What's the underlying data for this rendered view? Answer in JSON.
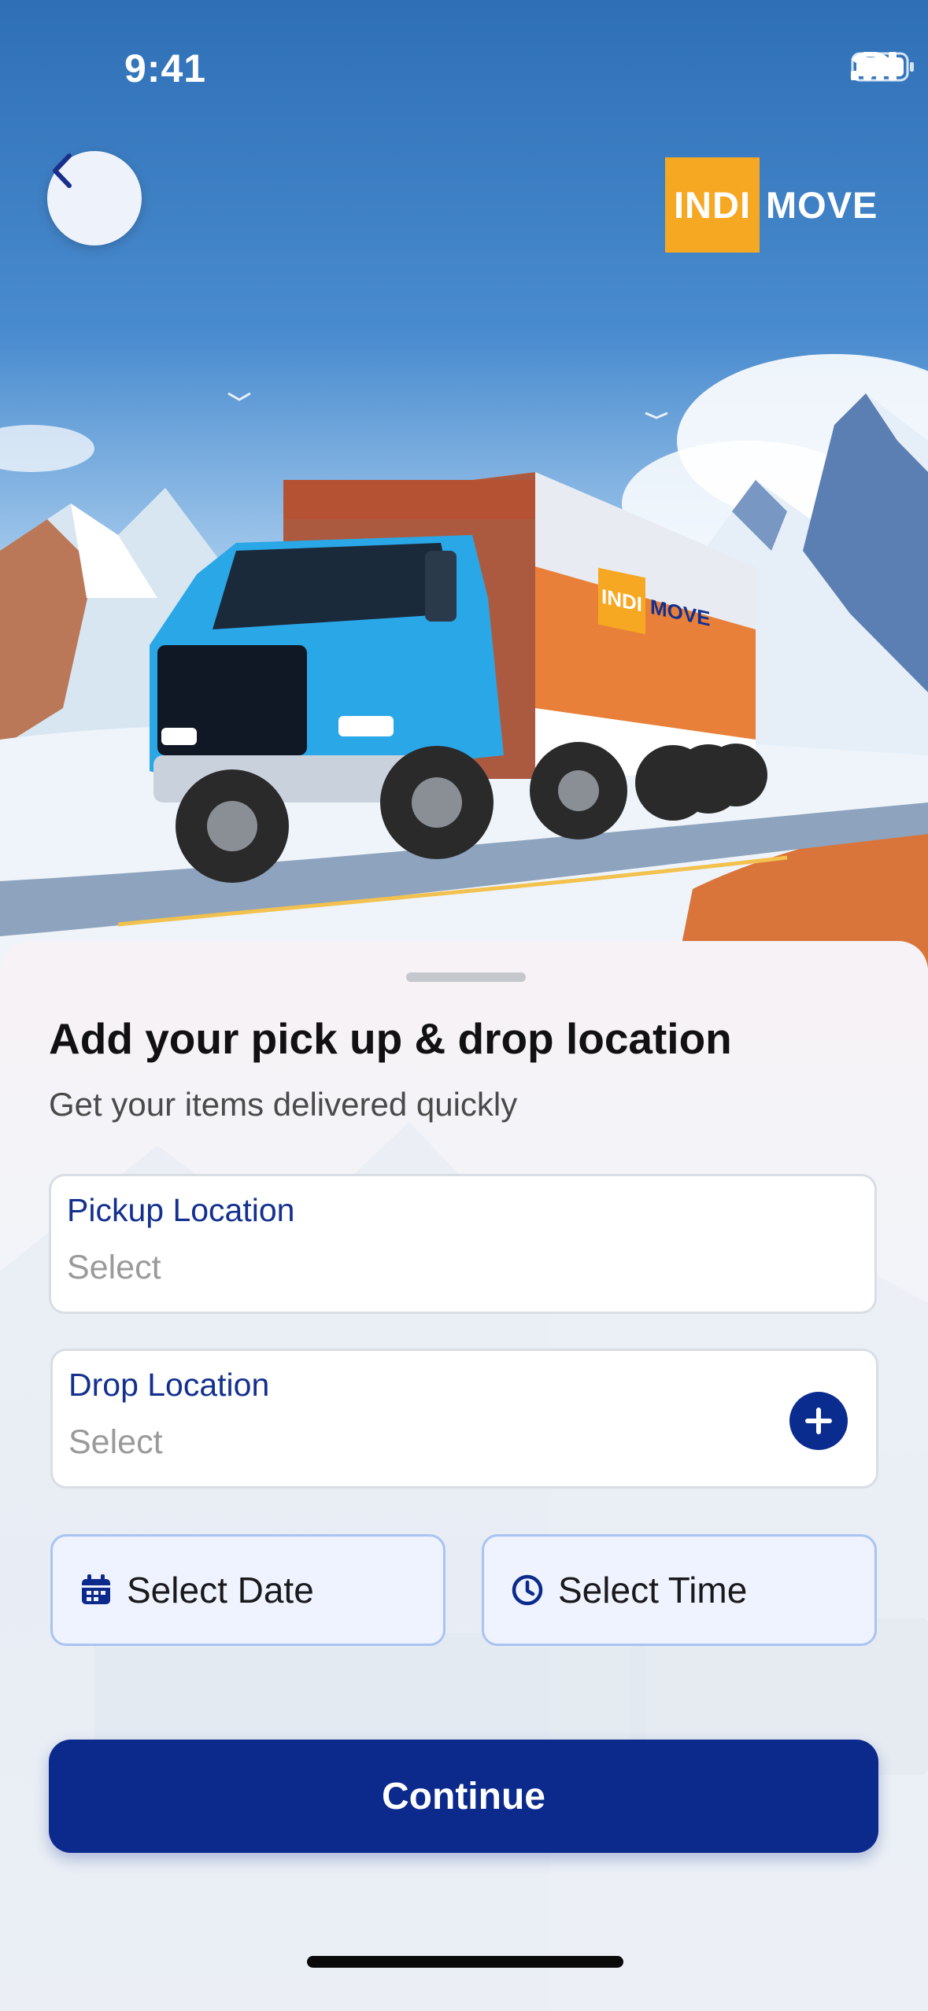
{
  "status_bar": {
    "time": "9:41"
  },
  "header": {
    "back_icon": "chevron-left-icon",
    "logo_left": "INDI",
    "logo_right": "MOVE"
  },
  "hero": {
    "truck_logo_left": "INDI",
    "truck_logo_right": "MOVE"
  },
  "sheet": {
    "title": "Add your pick up & drop location",
    "subtitle": "Get your items delivered quickly",
    "pickup": {
      "label": "Pickup Location",
      "value": "Select"
    },
    "drop": {
      "label": "Drop Location",
      "value": "Select",
      "add_icon": "plus-icon"
    },
    "date": {
      "label": "Select Date",
      "icon": "calendar-icon"
    },
    "time": {
      "label": "Select Time",
      "icon": "clock-icon"
    },
    "continue_label": "Continue"
  },
  "colors": {
    "primary": "#0b2a8c",
    "accent": "#f7a823",
    "label": "#13308f"
  }
}
